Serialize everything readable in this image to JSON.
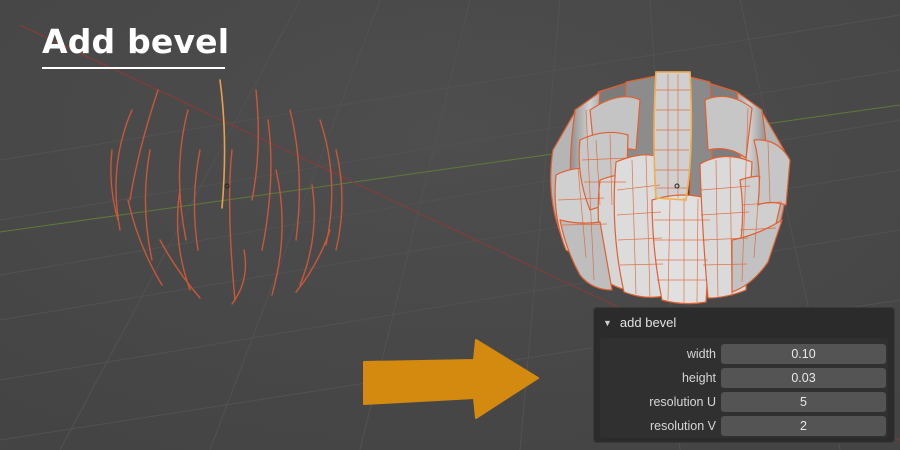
{
  "title": "Add bevel",
  "colors": {
    "background": "#484848",
    "wire": "#e0602f",
    "arrow": "#d38a0e",
    "mesh_face": "#bcbcbc"
  },
  "panel": {
    "title": "add bevel",
    "fields": [
      {
        "label": "width",
        "value": "0.10"
      },
      {
        "label": "height",
        "value": "0.03"
      },
      {
        "label": "resolution U",
        "value": "5"
      },
      {
        "label": "resolution V",
        "value": "2"
      }
    ]
  }
}
